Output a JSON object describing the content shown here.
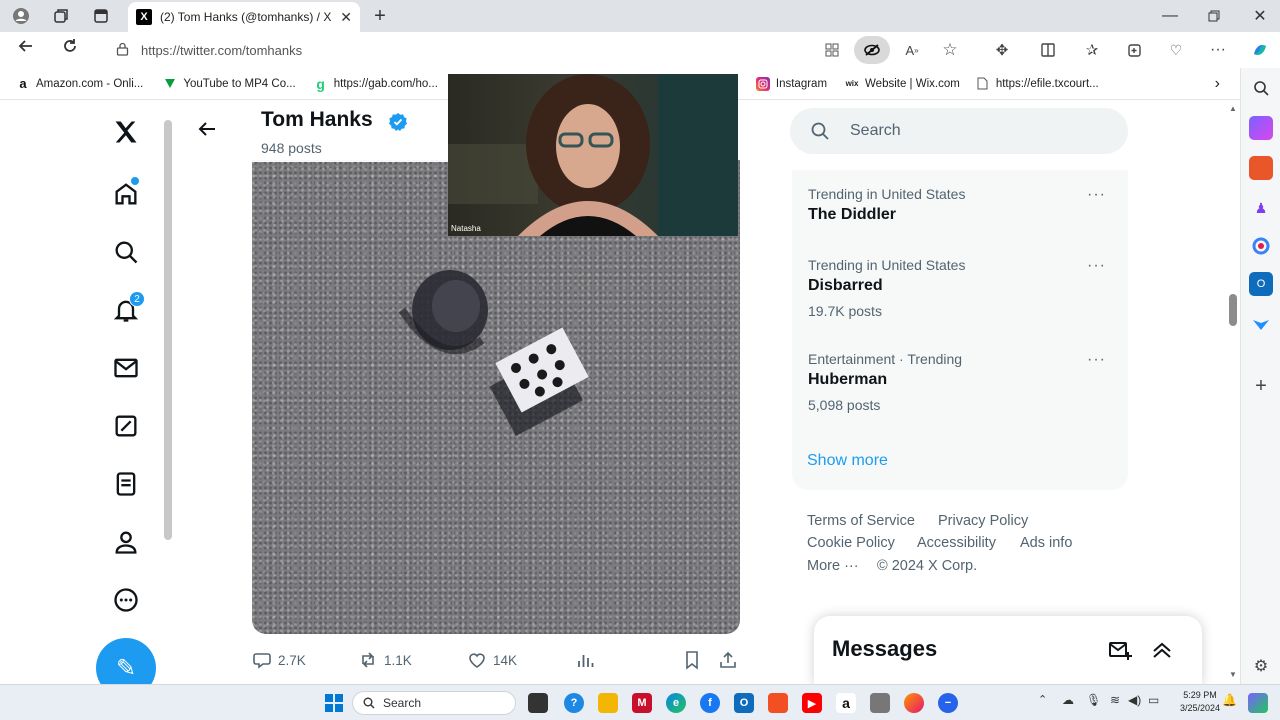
{
  "browser": {
    "tab_title": "(2) Tom Hanks (@tomhanks) / X",
    "tab_logo": "X",
    "url": "https://twitter.com/tomhanks",
    "new_tab": "+"
  },
  "bookmarks": [
    {
      "label": "Amazon.com - Onli...",
      "icon": "amazon-icon",
      "color": "#111111"
    },
    {
      "label": "YouTube to MP4 Co...",
      "icon": "triangle-icon",
      "color": "#0a9d3f"
    },
    {
      "label": "https://gab.com/ho...",
      "icon": "gab-icon",
      "color": "#21cf7a"
    },
    {
      "label": "Instagram",
      "icon": "instagram-icon",
      "color": "#e1306c"
    },
    {
      "label": "Website | Wix.com",
      "icon": "wix-icon",
      "color": "#222222"
    },
    {
      "label": "https://efile.txcourt...",
      "icon": "document-icon",
      "color": "#555555"
    }
  ],
  "nav": {
    "notification_count": "2"
  },
  "profile": {
    "name": "Tom Hanks",
    "posts_count": "948 posts"
  },
  "webcam": {
    "name_label": "Natasha"
  },
  "post_actions": {
    "replies": "2.7K",
    "reposts": "1.1K",
    "likes": "14K"
  },
  "search": {
    "placeholder": "Search"
  },
  "trends": [
    {
      "context": "Trending in United States",
      "name": "The Diddler",
      "count": ""
    },
    {
      "context": "Trending in United States",
      "name": "Disbarred",
      "count": "19.7K posts"
    },
    {
      "context": "Entertainment · Trending",
      "name": "Huberman",
      "count": "5,098 posts"
    }
  ],
  "show_more": "Show more",
  "footer": {
    "terms": "Terms of Service",
    "privacy": "Privacy Policy",
    "cookie": "Cookie Policy",
    "accessibility": "Accessibility",
    "ads": "Ads info",
    "more": "More ···",
    "copyright": "© 2024 X Corp."
  },
  "messages": {
    "title": "Messages"
  },
  "taskbar": {
    "search_label": "Search",
    "time": "5:29 PM",
    "date": "3/25/2024"
  },
  "colors": {
    "x_blue": "#1d9bf0",
    "text_primary": "#0f1419",
    "text_secondary": "#536471"
  }
}
